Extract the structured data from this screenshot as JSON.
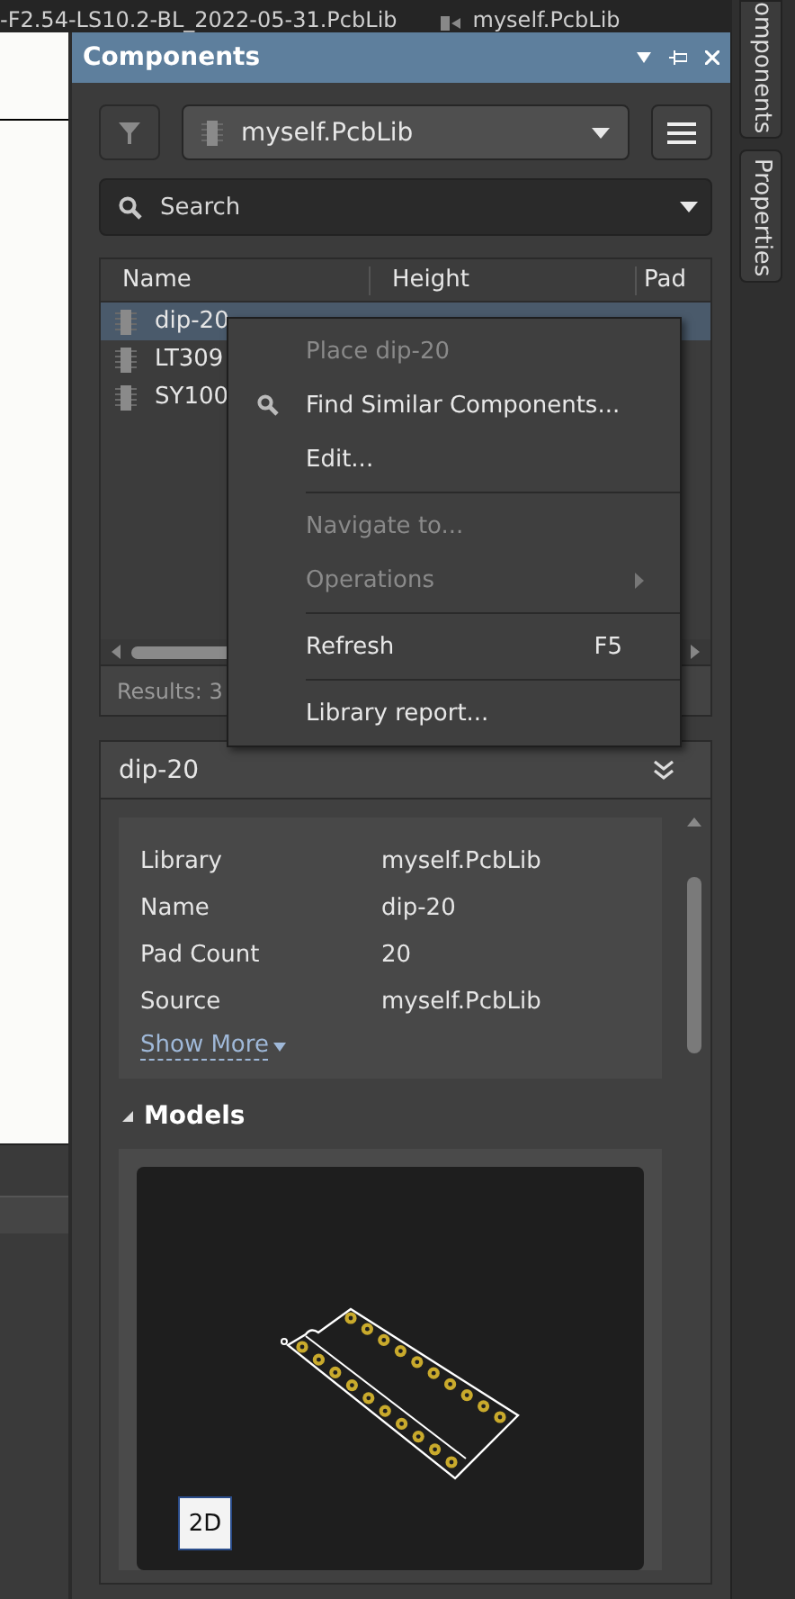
{
  "document_tabs": [
    {
      "label": "-F2.54-LS10.2-BL_2022-05-31.PcbLib"
    },
    {
      "label": "myself.PcbLib"
    }
  ],
  "panel": {
    "title": "Components"
  },
  "library_select": {
    "value": "myself.PcbLib"
  },
  "search": {
    "placeholder": "Search"
  },
  "table": {
    "columns": [
      "Name",
      "Height",
      "Pad"
    ],
    "rows": [
      {
        "name": "dip-20",
        "selected": true
      },
      {
        "name": "LT309",
        "selected": false
      },
      {
        "name": "SY100",
        "selected": false
      }
    ]
  },
  "results": "Results: 3",
  "context_menu": {
    "items": [
      {
        "kind": "item",
        "label": "Place dip-20",
        "disabled": true
      },
      {
        "kind": "search",
        "label": "Find Similar Components...",
        "disabled": false
      },
      {
        "kind": "item",
        "label": "Edit...",
        "disabled": false
      },
      {
        "kind": "separator"
      },
      {
        "kind": "item",
        "label": "Navigate to...",
        "disabled": true
      },
      {
        "kind": "submenu",
        "label": "Operations",
        "disabled": true
      },
      {
        "kind": "separator"
      },
      {
        "kind": "item",
        "label": "Refresh",
        "shortcut": "F5",
        "disabled": false
      },
      {
        "kind": "separator"
      },
      {
        "kind": "item",
        "label": "Library report...",
        "disabled": false
      }
    ]
  },
  "details": {
    "title": "dip-20",
    "properties": [
      {
        "label": "Library",
        "value": "myself.PcbLib"
      },
      {
        "label": "Name",
        "value": "dip-20"
      },
      {
        "label": "Pad Count",
        "value": "20"
      },
      {
        "label": "Source",
        "value": "myself.PcbLib"
      }
    ],
    "show_more": "Show More",
    "models_title": "Models",
    "view_button": "2D"
  },
  "side_tabs": [
    {
      "label": "omponents"
    },
    {
      "label": "Properties"
    }
  ]
}
